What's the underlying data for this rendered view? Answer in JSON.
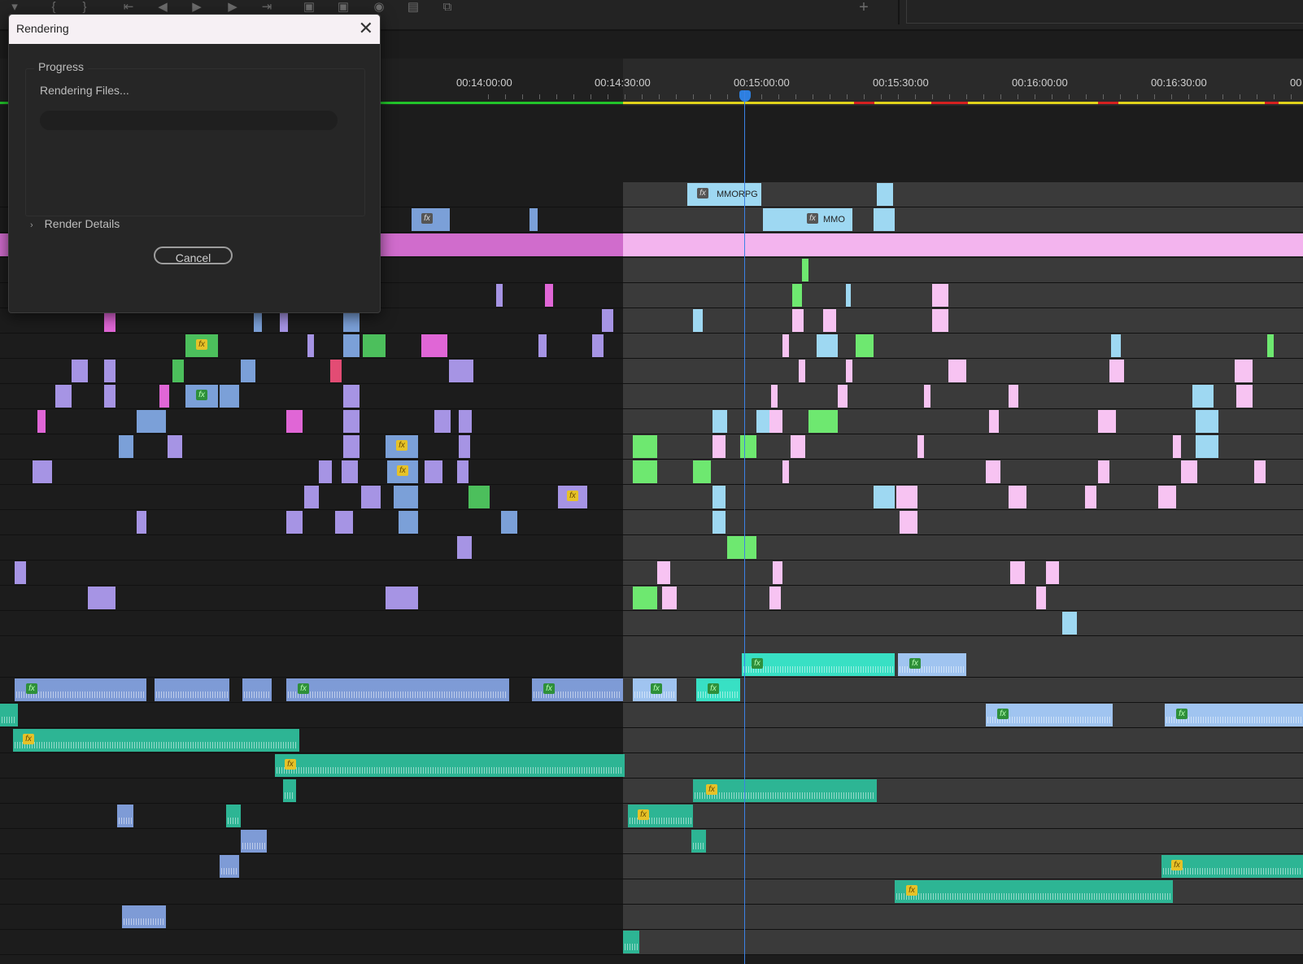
{
  "dialog": {
    "title": "Rendering",
    "close_label": "✕",
    "progress_group": "Progress",
    "status": "Rendering Files...",
    "progress_percent": 0,
    "details_chevron": "›",
    "details_label": "Render Details",
    "cancel_label": "Cancel"
  },
  "toolbar": {
    "icons": [
      "marker-icon",
      "in-point-icon",
      "out-point-icon",
      "go-to-in-icon",
      "step-back-icon",
      "play-icon",
      "step-forward-icon",
      "go-to-out-icon",
      "insert-icon",
      "overwrite-icon",
      "camera-icon",
      "button-editor-icon",
      "extract-icon"
    ],
    "add_label": "+"
  },
  "timeline": {
    "timecodes": [
      "00:14:00:00",
      "00:14:30:00",
      "00:15:00:00",
      "00:15:30:00",
      "00:16:00:00",
      "00:16:30:00",
      "00"
    ],
    "clip_labels": {
      "mmorpg": "MMORPG",
      "mmo": "MMO",
      "fx": "fx"
    }
  },
  "colors": {
    "accent": "#2d7fe0",
    "render_green": "#22c42a",
    "render_yellow": "#e0d21a",
    "render_red": "#d42020",
    "adjustment_layer": "#f3b4ee",
    "video_clip_light": "#9ed8f2",
    "video_clip_pink": "#f7c3f2",
    "video_clip_green": "#6ee870",
    "audio_clip": "#2db594"
  }
}
